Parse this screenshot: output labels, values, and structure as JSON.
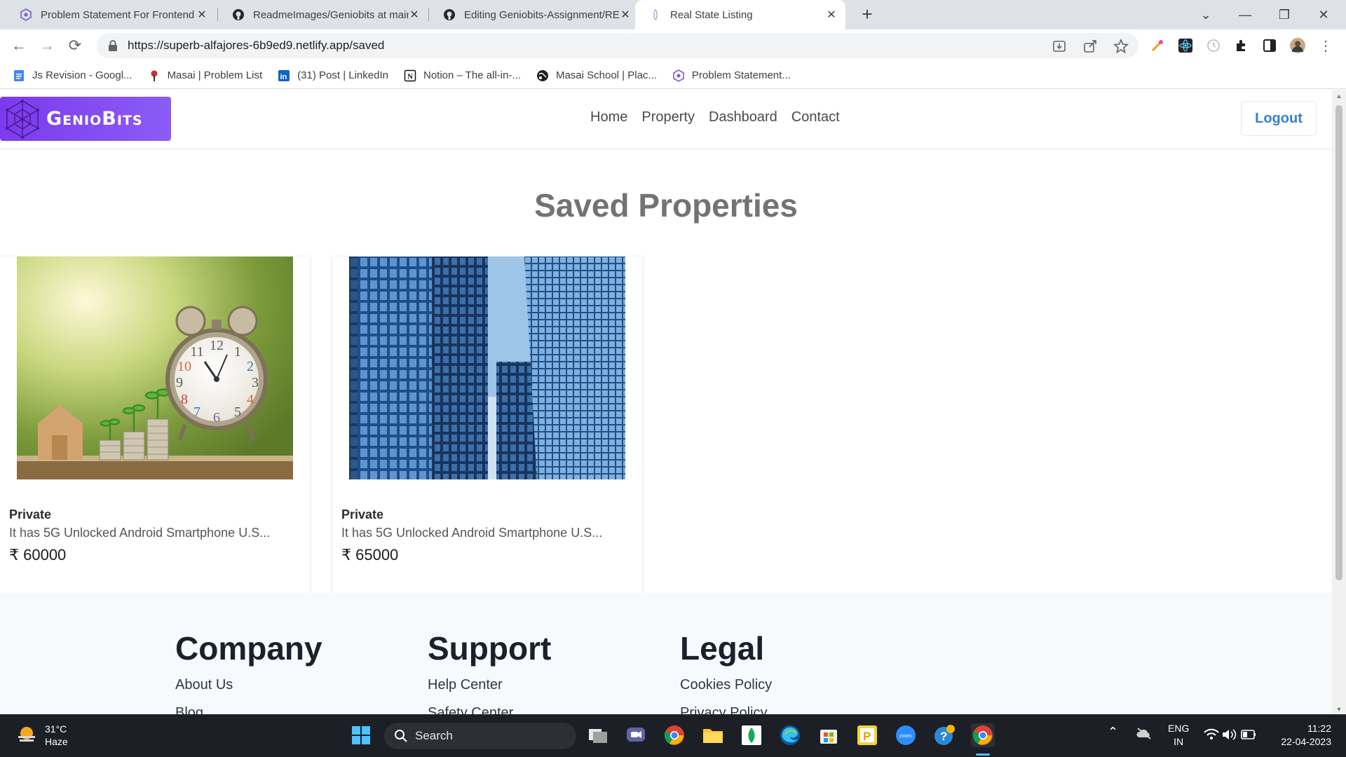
{
  "browser": {
    "tabs": [
      {
        "title": "Problem Statement For Frontend",
        "active": false
      },
      {
        "title": "ReadmeImages/Geniobits at main",
        "active": false
      },
      {
        "title": "Editing Geniobits-Assignment/REA",
        "active": false
      },
      {
        "title": "Real State Listing",
        "active": true
      }
    ],
    "url": "https://superb-alfajores-6b9ed9.netlify.app/saved",
    "bookmarks": [
      {
        "label": "Js Revision - Googl...",
        "icon": "google-docs-icon"
      },
      {
        "label": "Masai | Problem List",
        "icon": "masai-icon"
      },
      {
        "label": "(31) Post | LinkedIn",
        "icon": "linkedin-icon"
      },
      {
        "label": "Notion – The all-in-...",
        "icon": "notion-icon"
      },
      {
        "label": "Masai School | Plac...",
        "icon": "globe-icon"
      },
      {
        "label": "Problem Statement...",
        "icon": "geniobits-icon"
      }
    ]
  },
  "site": {
    "logo_text": "GenioBits",
    "nav": [
      "Home",
      "Property",
      "Dashboard",
      "Contact"
    ],
    "logout_label": "Logout",
    "heading": "Saved Properties",
    "properties": [
      {
        "type": "Private",
        "description": "It has 5G Unlocked Android Smartphone U.S...",
        "price": "₹ 60000",
        "image": "clock-coins-house-photo"
      },
      {
        "type": "Private",
        "description": "It has 5G Unlocked Android Smartphone U.S...",
        "price": "₹ 65000",
        "image": "glass-skyscrapers-photo"
      }
    ],
    "footer": {
      "columns": [
        {
          "title": "Company",
          "links": [
            "About Us",
            "Blog"
          ]
        },
        {
          "title": "Support",
          "links": [
            "Help Center",
            "Safety Center"
          ]
        },
        {
          "title": "Legal",
          "links": [
            "Cookies Policy",
            "Privacy Policy"
          ]
        }
      ]
    }
  },
  "taskbar": {
    "weather_temp": "31°C",
    "weather_desc": "Haze",
    "search_label": "Search",
    "lang_top": "ENG",
    "lang_bottom": "IN",
    "time": "11:22",
    "date": "22-04-2023"
  },
  "colors": {
    "brand_purple": "#7c3aed",
    "logout_blue": "#3182ce",
    "taskbar_bg": "#1c1f26"
  }
}
